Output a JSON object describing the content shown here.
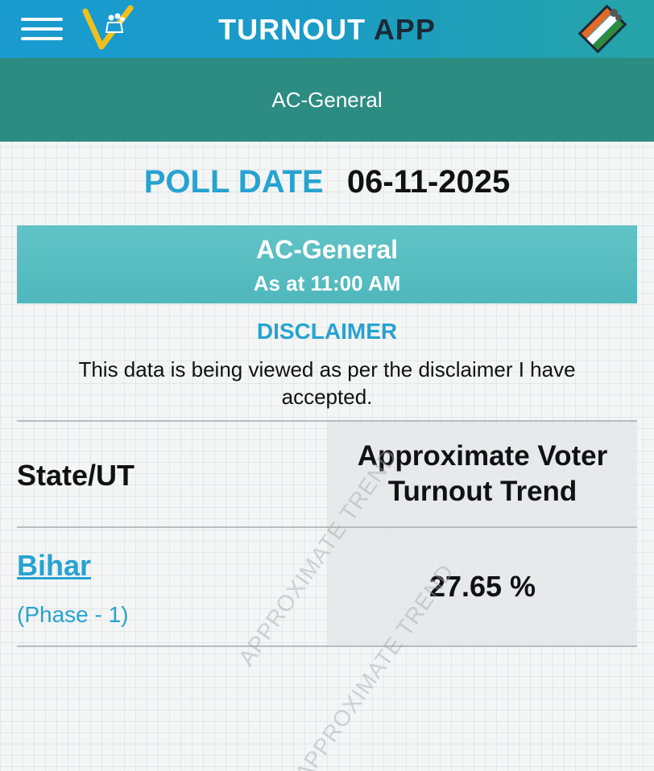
{
  "header": {
    "title_main": "TURNOUT",
    "title_app": "APP",
    "menu_icon": "hamburger-menu-icon",
    "logo_icon": "voter-turnout-logo-icon",
    "eci_icon": "election-commission-logo-icon"
  },
  "subheader": {
    "label": "AC-General"
  },
  "poll": {
    "label": "POLL DATE",
    "date": "06-11-2025"
  },
  "band": {
    "title": "AC-General",
    "time": "As at 11:00 AM"
  },
  "disclaimer": {
    "title": "DISCLAIMER",
    "text": "This data is being viewed as per the disclaimer I have accepted."
  },
  "table": {
    "columns": [
      "State/UT",
      "Approximate Voter Turnout Trend"
    ],
    "rows": [
      {
        "state": "Bihar",
        "phase": "(Phase - 1)",
        "turnout": "27.65 %"
      }
    ]
  },
  "watermark": "APPROXIMATE TREND",
  "colors": {
    "header_blue": "#1a9bd0",
    "subheader_teal": "#2c8c82",
    "band_teal": "#5cbfc3",
    "accent_blue": "#26a3d1"
  }
}
